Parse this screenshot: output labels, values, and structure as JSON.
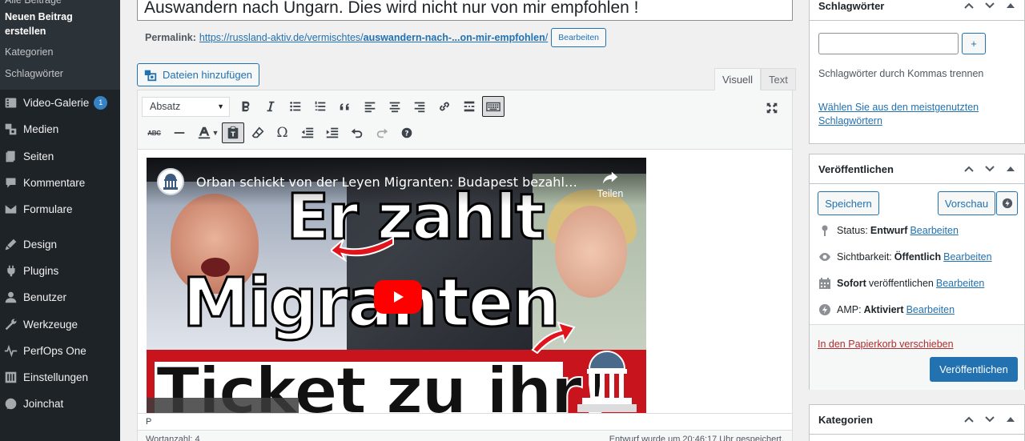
{
  "sidebar": {
    "submenu": [
      {
        "label": "Alle Beiträge",
        "current": false
      },
      {
        "label": "Neuen Beitrag erstellen",
        "current": true
      },
      {
        "label": "Kategorien",
        "current": false
      },
      {
        "label": "Schlagwörter",
        "current": false
      }
    ],
    "menu": [
      {
        "label": "Video-Galerie",
        "icon": "video-gallery-icon",
        "badge": "1"
      },
      {
        "label": "Medien",
        "icon": "media-icon"
      },
      {
        "label": "Seiten",
        "icon": "pages-icon"
      },
      {
        "label": "Kommentare",
        "icon": "comments-icon"
      },
      {
        "label": "Formulare",
        "icon": "forms-icon"
      },
      {
        "label": "Design",
        "icon": "design-icon"
      },
      {
        "label": "Plugins",
        "icon": "plugins-icon"
      },
      {
        "label": "Benutzer",
        "icon": "users-icon"
      },
      {
        "label": "Werkzeuge",
        "icon": "tools-icon"
      },
      {
        "label": "PerfOps One",
        "icon": "perfops-icon"
      },
      {
        "label": "Einstellungen",
        "icon": "settings-icon"
      },
      {
        "label": "Joinchat",
        "icon": "joinchat-icon"
      }
    ]
  },
  "editor": {
    "title_value": "Auswandern nach Ungarn. Dies wird nicht nur von mir empfohlen !",
    "permalink_label": "Permalink:",
    "permalink_base": "https://russland-aktiv.de/vermischtes/",
    "permalink_slug": "auswandern-nach-...on-mir-empfohlen",
    "permalink_tail": "/",
    "permalink_edit": "Bearbeiten",
    "add_media": "Dateien hinzufügen",
    "tab_visual": "Visuell",
    "tab_text": "Text",
    "format_select": "Absatz",
    "path_label": "P",
    "word_count": "Wortanzahl: 4",
    "draft_saved": "Entwurf wurde um 20:46:17 Uhr gespeichert."
  },
  "video": {
    "title": "Orban schickt von der Leyen Migranten: Budapest bezahlt Ti...",
    "share": "Teilen",
    "text_1": "Er zahlt",
    "text_2": "Migranten",
    "text_3": "Ticket zu ihr!"
  },
  "tags_box": {
    "title": "Schlagwörter",
    "add_button": "+",
    "hint": "Schlagwörter durch Kommas trennen",
    "popular_link": "Wählen Sie aus den meistgenutzten Schlagwörtern"
  },
  "publish_box": {
    "title": "Veröffentlichen",
    "save": "Speichern",
    "preview": "Vorschau",
    "status_label": "Status:",
    "status_value": "Entwurf",
    "visibility_label": "Sichtbarkeit:",
    "visibility_value": "Öffentlich",
    "schedule_value": "Sofort",
    "schedule_label": "veröffentlichen",
    "amp_label": "AMP:",
    "amp_value": "Aktiviert",
    "edit": "Bearbeiten",
    "trash": "In den Papierkorb verschieben",
    "publish": "Veröffentlichen"
  },
  "categories_box": {
    "title": "Kategorien"
  },
  "colors": {
    "admin_sidebar": "#1d2327",
    "primary": "#2271b1",
    "danger": "#b32d2e",
    "youtube_red": "#ff0000"
  }
}
